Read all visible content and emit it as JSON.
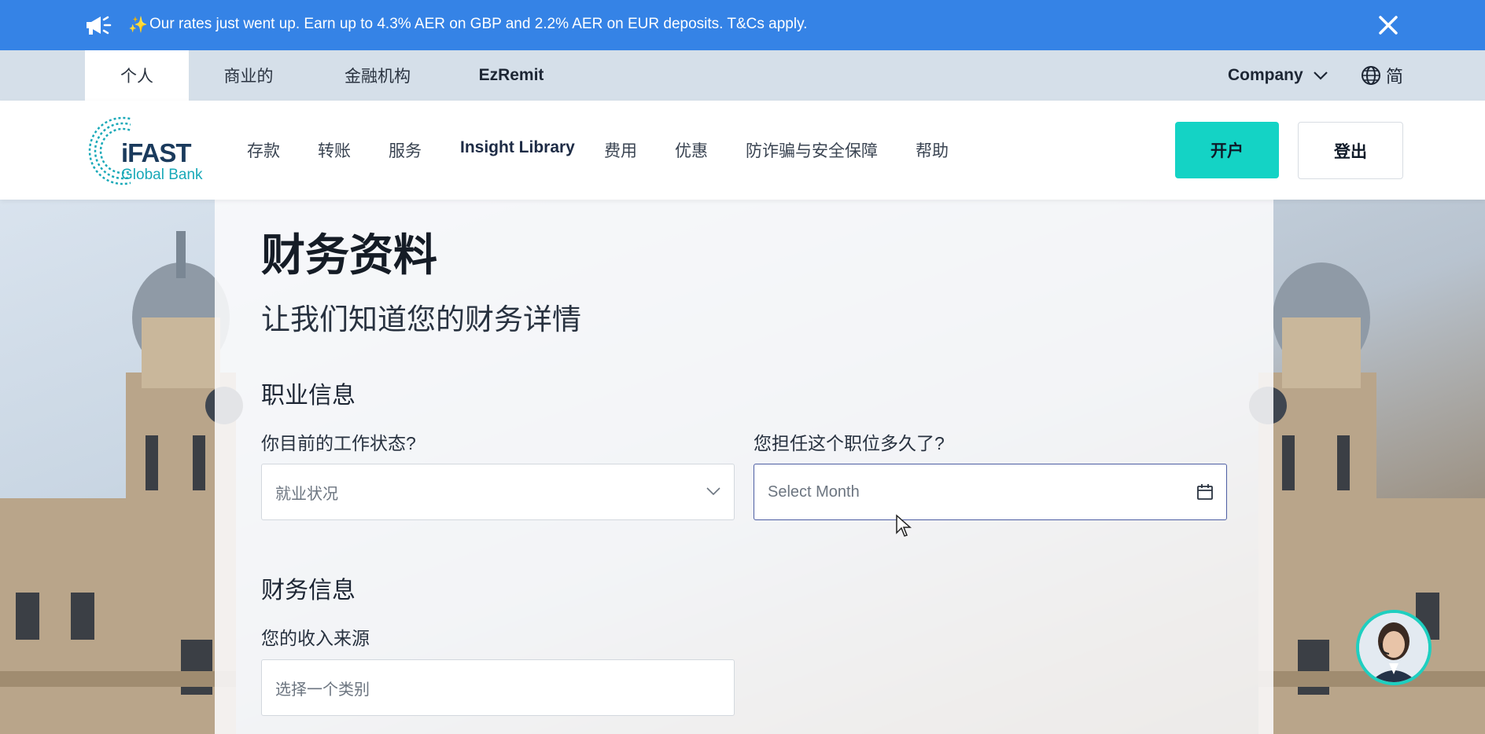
{
  "announcement": {
    "text": "Our rates just went up. Earn up to 4.3% AER on GBP and 2.2% AER on EUR deposits. T&Cs apply.",
    "sparkle": "✨",
    "icon": "megaphone-icon",
    "close_icon": "close-icon"
  },
  "segments": [
    {
      "label": "个人",
      "active": true
    },
    {
      "label": "商业的",
      "active": false
    },
    {
      "label": "金融机构",
      "active": false
    },
    {
      "label": "EzRemit",
      "active": false
    }
  ],
  "company_menu": {
    "label": "Company"
  },
  "language": {
    "label": "简"
  },
  "logo": {
    "brand": "iFAST",
    "sub": "Global Bank"
  },
  "nav": [
    "存款",
    "转账",
    "服务",
    "Insight Library",
    "费用",
    "优惠",
    "防诈骗与安全保障",
    "帮助"
  ],
  "buttons": {
    "open_account": "开户",
    "logout": "登出"
  },
  "form": {
    "title": "财务资料",
    "subtitle": "让我们知道您的财务详情",
    "employment_section": "职业信息",
    "employment_status_label": "你目前的工作状态?",
    "employment_status_placeholder": "就业状况",
    "duration_label": "您担任这个职位多久了?",
    "duration_placeholder": "Select Month",
    "financial_section": "财务信息",
    "income_source_label": "您的收入来源",
    "income_source_placeholder": "选择一个类别"
  },
  "colors": {
    "announcement_bg": "#3583e6",
    "segment_bar_bg": "#d5dfe9",
    "primary_button": "#14d3c5",
    "focus_border": "#4d5ea3"
  }
}
